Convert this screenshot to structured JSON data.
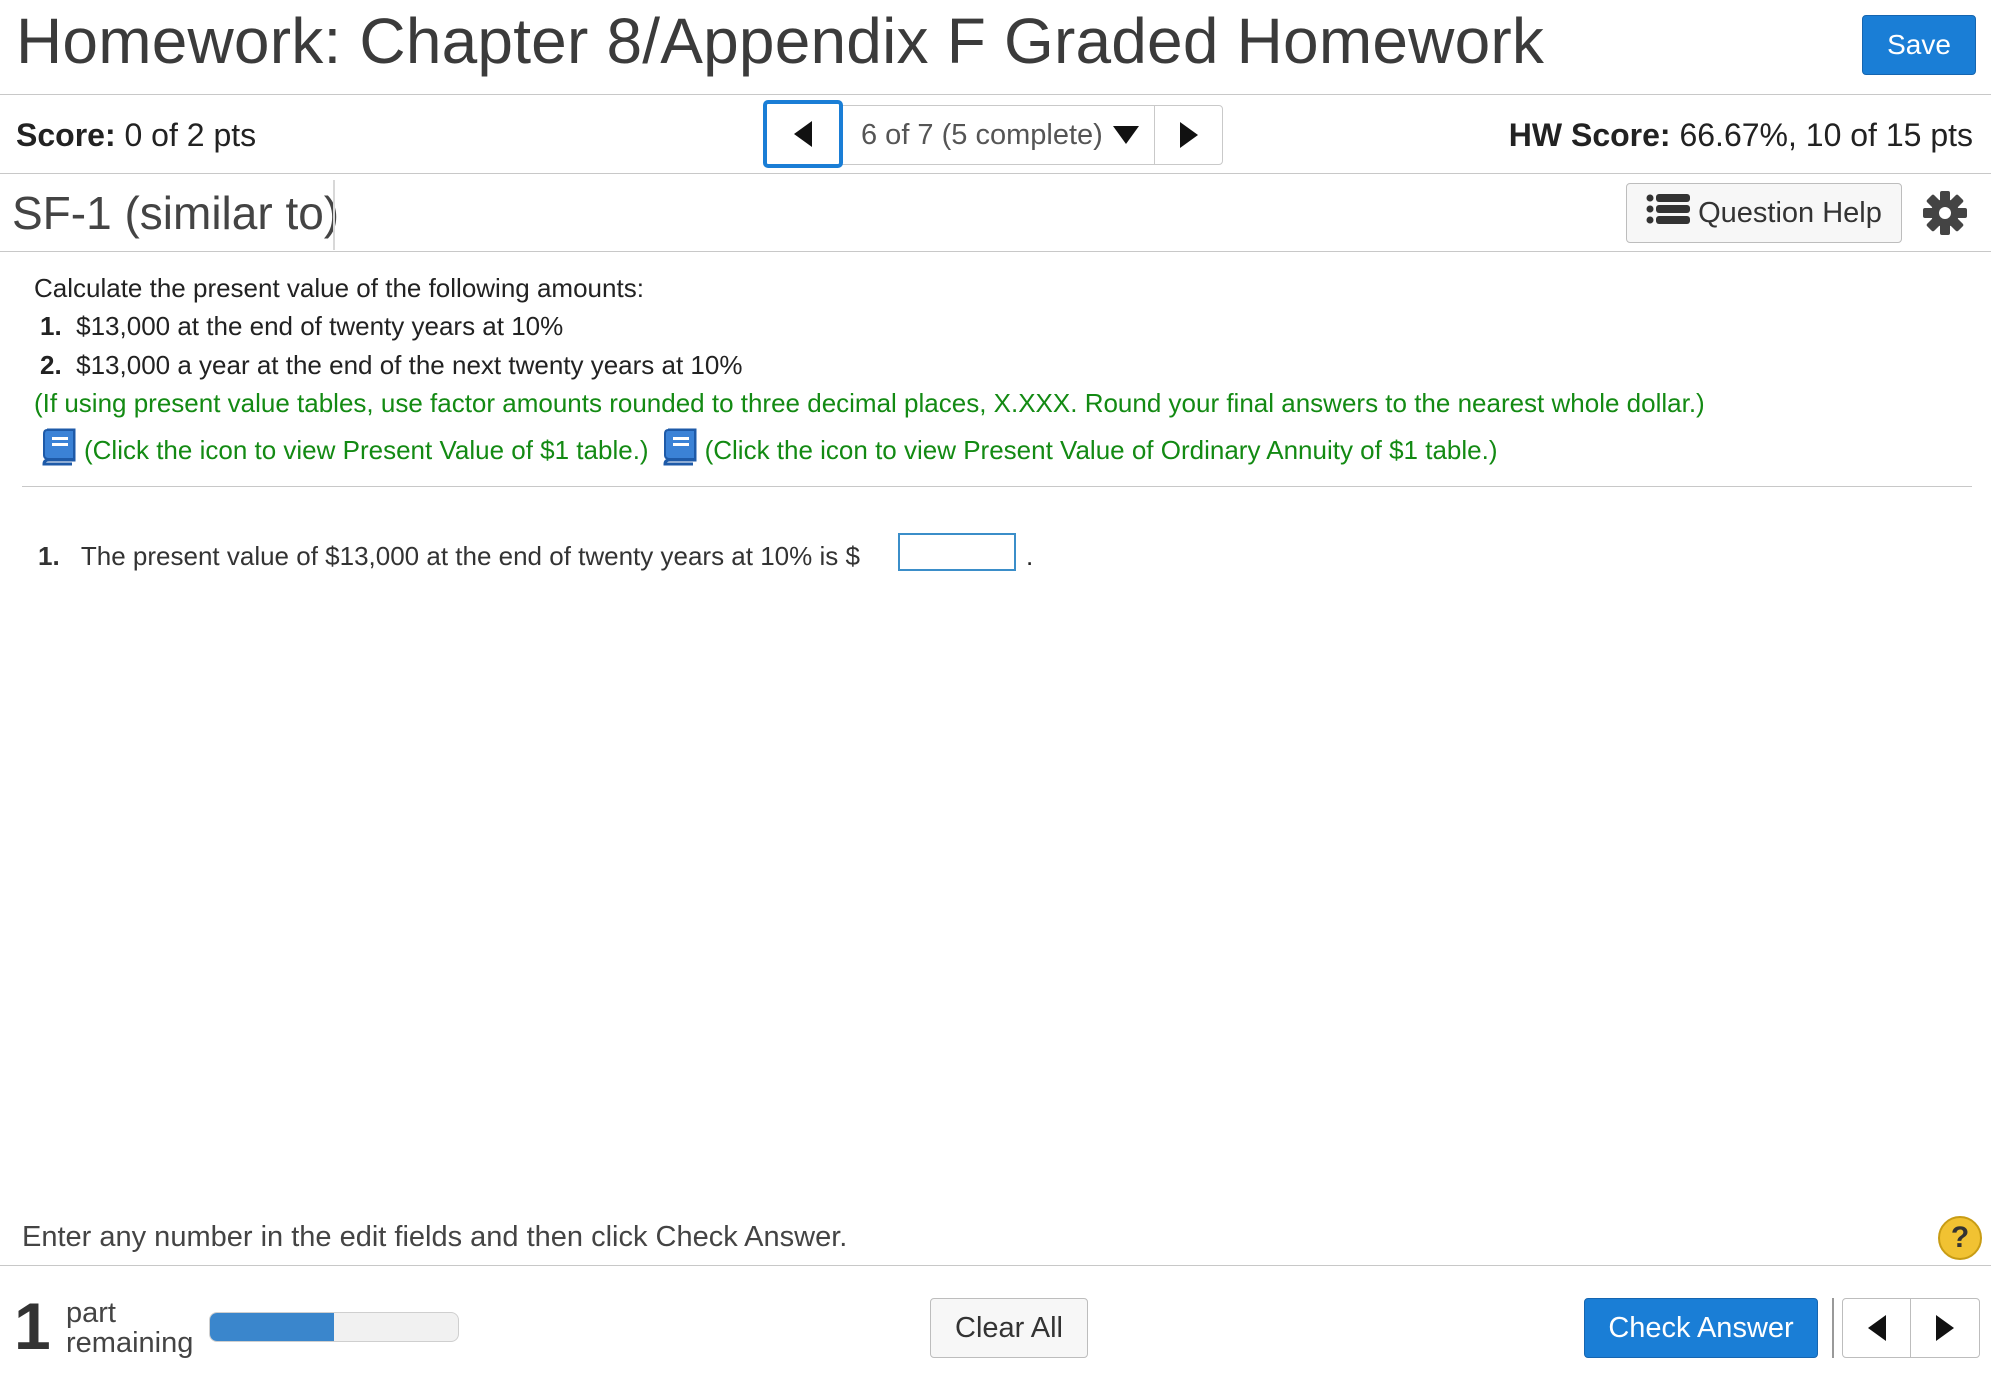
{
  "header": {
    "title": "Homework: Chapter 8/Appendix F Graded Homework",
    "save_label": "Save"
  },
  "score_bar": {
    "score_label": "Score:",
    "score_value": "0 of 2 pts",
    "question_nav": "6 of 7 (5 complete)",
    "hw_score_label": "HW Score:",
    "hw_score_value": "66.67%, 10 of 15 pts"
  },
  "question_header": {
    "id": "SF-1 (similar to)",
    "help_label": "Question Help"
  },
  "problem": {
    "intro": "Calculate the present value of the following amounts:",
    "items": [
      {
        "num": "1.",
        "text": "$13,000 at the end of twenty years at 10%"
      },
      {
        "num": "2.",
        "text": "$13,000 a year at the end of the next twenty years at 10%"
      }
    ],
    "instruction": "(If using present value tables, use factor amounts rounded to three decimal places, X.XXX. Round your final answers to the nearest whole dollar.)",
    "link1": "(Click the icon to view Present Value of $1 table.)",
    "link2": "(Click the icon to view Present Value of Ordinary Annuity of $1 table.)"
  },
  "answer": {
    "num": "1.",
    "prompt": "The present value of $13,000 at the end of twenty years at 10% is $",
    "value": "",
    "suffix": "."
  },
  "footer": {
    "message": "Enter any number in the edit fields and then click Check Answer.",
    "help_symbol": "?",
    "parts_count": "1",
    "parts_line1": "part",
    "parts_line2": "remaining",
    "progress": 0.5,
    "clear_label": "Clear All",
    "check_label": "Check Answer"
  },
  "colors": {
    "accent": "#1a7ed6",
    "instruction_green": "#138a13",
    "help_yellow": "#f1c232"
  }
}
